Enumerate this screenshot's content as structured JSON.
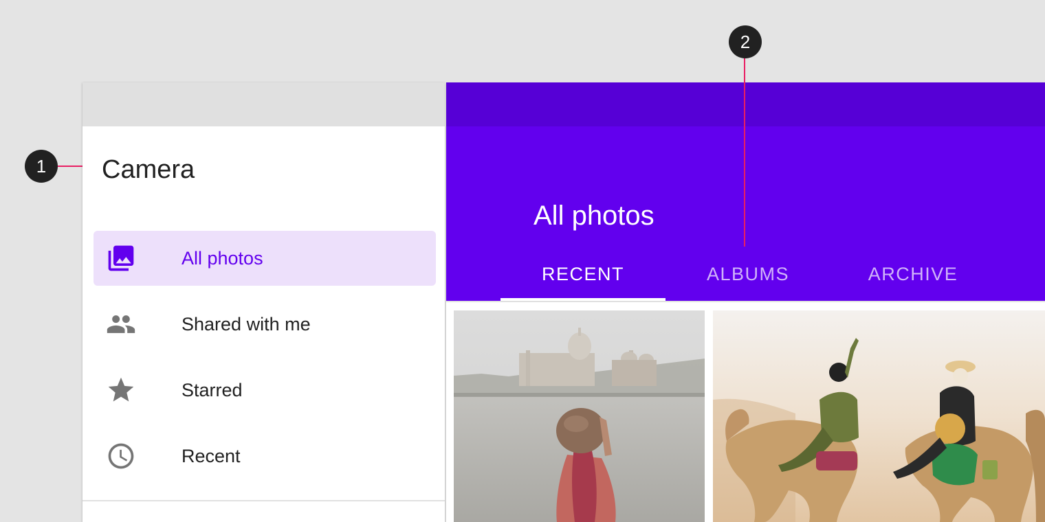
{
  "callouts": {
    "first": "1",
    "second": "2"
  },
  "colors": {
    "primary": "#6200ee",
    "primary_dark": "#5600d6",
    "active_item_bg": "#ede0fb",
    "callout_line": "#e91e63"
  },
  "drawer": {
    "title": "Camera",
    "items": [
      {
        "label": "All photos",
        "icon": "photo-library-icon",
        "active": true
      },
      {
        "label": "Shared with me",
        "icon": "people-icon",
        "active": false
      },
      {
        "label": "Starred",
        "icon": "star-icon",
        "active": false
      },
      {
        "label": "Recent",
        "icon": "clock-icon",
        "active": false
      }
    ]
  },
  "app_bar": {
    "title": "All photos",
    "tabs": [
      {
        "label": "RECENT",
        "active": true
      },
      {
        "label": "ALBUMS",
        "active": false
      },
      {
        "label": "ARCHIVE",
        "active": false
      }
    ]
  },
  "gallery": {
    "photos": [
      {
        "subject": "taj-mahal-photo"
      },
      {
        "subject": "camel-riders-photo"
      }
    ]
  }
}
